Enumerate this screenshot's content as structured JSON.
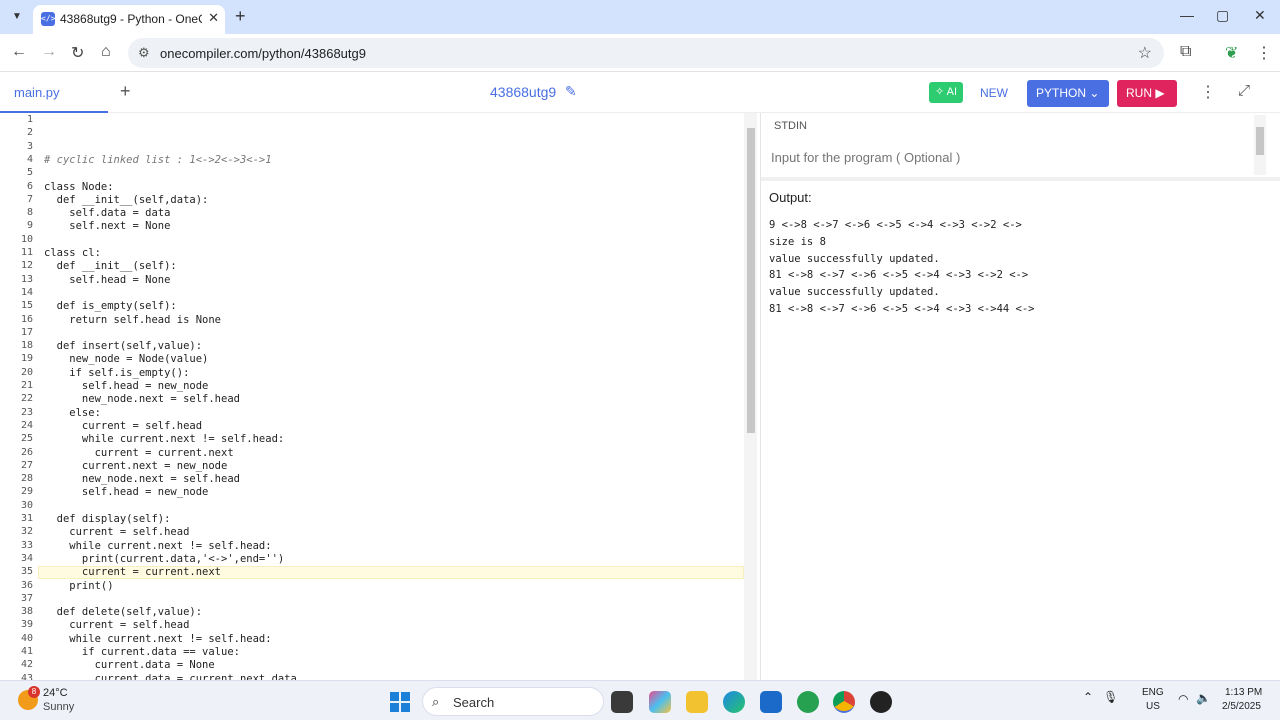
{
  "browser": {
    "tab_title": "43868utg9 - Python - OneComp",
    "tab_favicon": "</>",
    "url": "onecompiler.com/python/43868utg9",
    "window_controls": [
      "—",
      "▢",
      "✕"
    ]
  },
  "toolbar": {
    "file_tab": "main.py",
    "project_name": "43868utg9",
    "ai_label": "AI",
    "new_label": "NEW",
    "language_label": "PYTHON",
    "run_label": "RUN"
  },
  "editor": {
    "lines": [
      "",
      "",
      "",
      "# cyclic linked list : 1<->2<->3<->1",
      "",
      "class Node:",
      "  def __init__(self,data):",
      "    self.data = data",
      "    self.next = None",
      "",
      "class cl:",
      "  def __init__(self):",
      "    self.head = None",
      "",
      "  def is_empty(self):",
      "    return self.head is None",
      "",
      "  def insert(self,value):",
      "    new_node = Node(value)",
      "    if self.is_empty():",
      "      self.head = new_node",
      "      new_node.next = self.head",
      "    else:",
      "      current = self.head",
      "      while current.next != self.head:",
      "        current = current.next",
      "      current.next = new_node",
      "      new_node.next = self.head",
      "      self.head = new_node",
      "",
      "  def display(self):",
      "    current = self.head",
      "    while current.next != self.head:",
      "      print(current.data,'<->',end='')",
      "      current = current.next",
      "    print()",
      "",
      "  def delete(self,value):",
      "    current = self.head",
      "    while current.next != self.head:",
      "      if current.data == value:",
      "        current.data = None",
      "        current.data = current.next.data"
    ]
  },
  "stdin": {
    "label": "STDIN",
    "placeholder": "Input for the program ( Optional )"
  },
  "output": {
    "label": "Output:",
    "lines": [
      "9 <->8 <->7 <->6 <->5 <->4 <->3 <->2 <->",
      "size is 8",
      "value successfully updated.",
      "81 <->8 <->7 <->6 <->5 <->4 <->3 <->2 <->",
      "value successfully updated.",
      "81 <->8 <->7 <->6 <->5 <->4 <->3 <->44 <->"
    ]
  },
  "taskbar": {
    "weather_badge": "8",
    "temperature": "24°C",
    "weather": "Sunny",
    "search_label": "Search",
    "lang_line1": "ENG",
    "lang_line2": "US",
    "time": "1:13 PM",
    "date": "2/5/2025"
  }
}
